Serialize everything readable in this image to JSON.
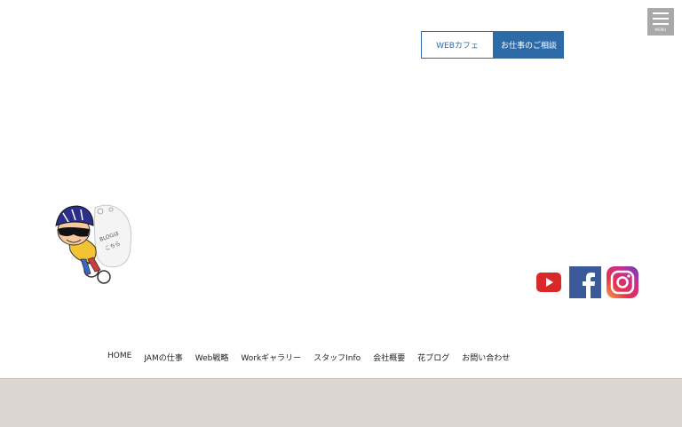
{
  "header": {
    "menu_label": "MENU",
    "buttons": {
      "web_cafe": "WEBカフェ",
      "consult": "お仕事のご相談"
    }
  },
  "mascot": {
    "bubble_text_1": "BLOGは",
    "bubble_text_2": "こちら"
  },
  "social": {
    "youtube_icon": "youtube-icon",
    "facebook_icon": "facebook-icon",
    "instagram_icon": "instagram-icon"
  },
  "nav": {
    "items": [
      "HOME",
      "JAMの仕事",
      "Web戦略",
      "Workギャラリー",
      "スタッフInfo",
      "会社概要",
      "花ブログ",
      "お問い合わせ"
    ]
  },
  "colors": {
    "accent": "#2d6aa8",
    "footer": "#dcd5d0",
    "menu_bg": "#a9a9a9"
  }
}
